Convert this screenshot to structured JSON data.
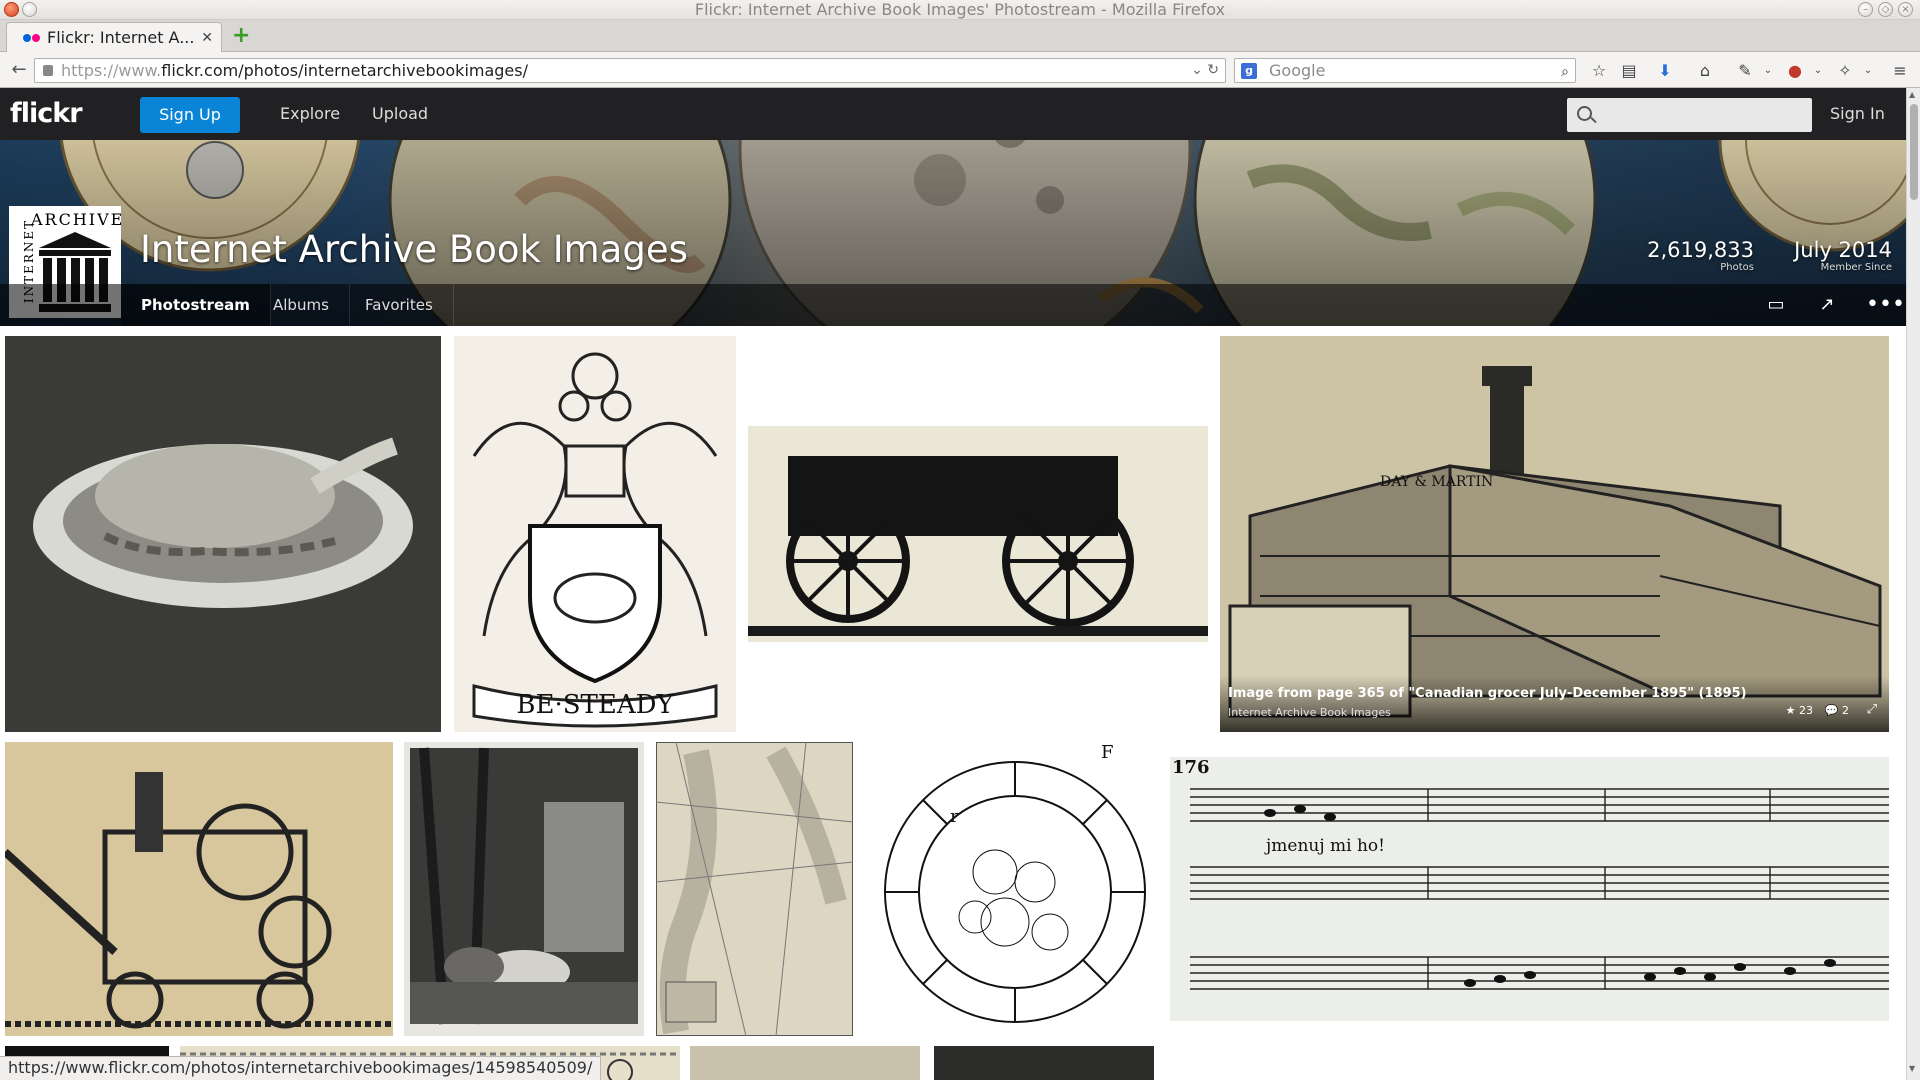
{
  "window": {
    "title": "Flickr: Internet Archive Book Images' Photostream - Mozilla Firefox"
  },
  "browser": {
    "tab_title": "Flickr: Internet A...",
    "url_scheme_prefix": "https://www.",
    "url_host": "flickr.com",
    "url_path": "/photos/internetarchivebookimages/",
    "search_placeholder": "Google",
    "status_url": "https://www.flickr.com/photos/internetarchivebookimages/14598540509/"
  },
  "flickr_header": {
    "logo": "flickr",
    "signup_label": "Sign Up",
    "explore_label": "Explore",
    "upload_label": "Upload",
    "signin_label": "Sign In",
    "brand_color": "#0a84d6"
  },
  "profile": {
    "name": "Internet Archive Book Images",
    "avatar_word": "ARCHIVE",
    "avatar_vertical_word": "INTERNET",
    "photos_count": "2,619,833",
    "photos_label": "Photos",
    "member_since": "July 2014",
    "member_since_label": "Member Since",
    "tabs": [
      {
        "label": "Photostream",
        "active": true
      },
      {
        "label": "Albums",
        "active": false
      },
      {
        "label": "Favorites",
        "active": false
      }
    ]
  },
  "hover_photo": {
    "title": "Image from page 365 of \"Canadian grocer July-December 1895\" (1895)",
    "owner": "Internet Archive Book Images",
    "faves": "23",
    "comments": "2"
  },
  "photos": [
    {
      "subject": "turkey-platter"
    },
    {
      "subject": "coat-of-arms",
      "caption": "BE·STEADY"
    },
    {
      "subject": "wagon"
    },
    {
      "subject": "factory-building",
      "sign": "DAY & MARTIN"
    },
    {
      "subject": "engine-machine"
    },
    {
      "subject": "horses-forest"
    },
    {
      "subject": "map-sketch"
    },
    {
      "subject": "cell-diagram",
      "label_r": "r",
      "label_f": "F"
    },
    {
      "subject": "sheet-music",
      "page": "176",
      "lyric": "jmenuj mi ho!"
    }
  ]
}
